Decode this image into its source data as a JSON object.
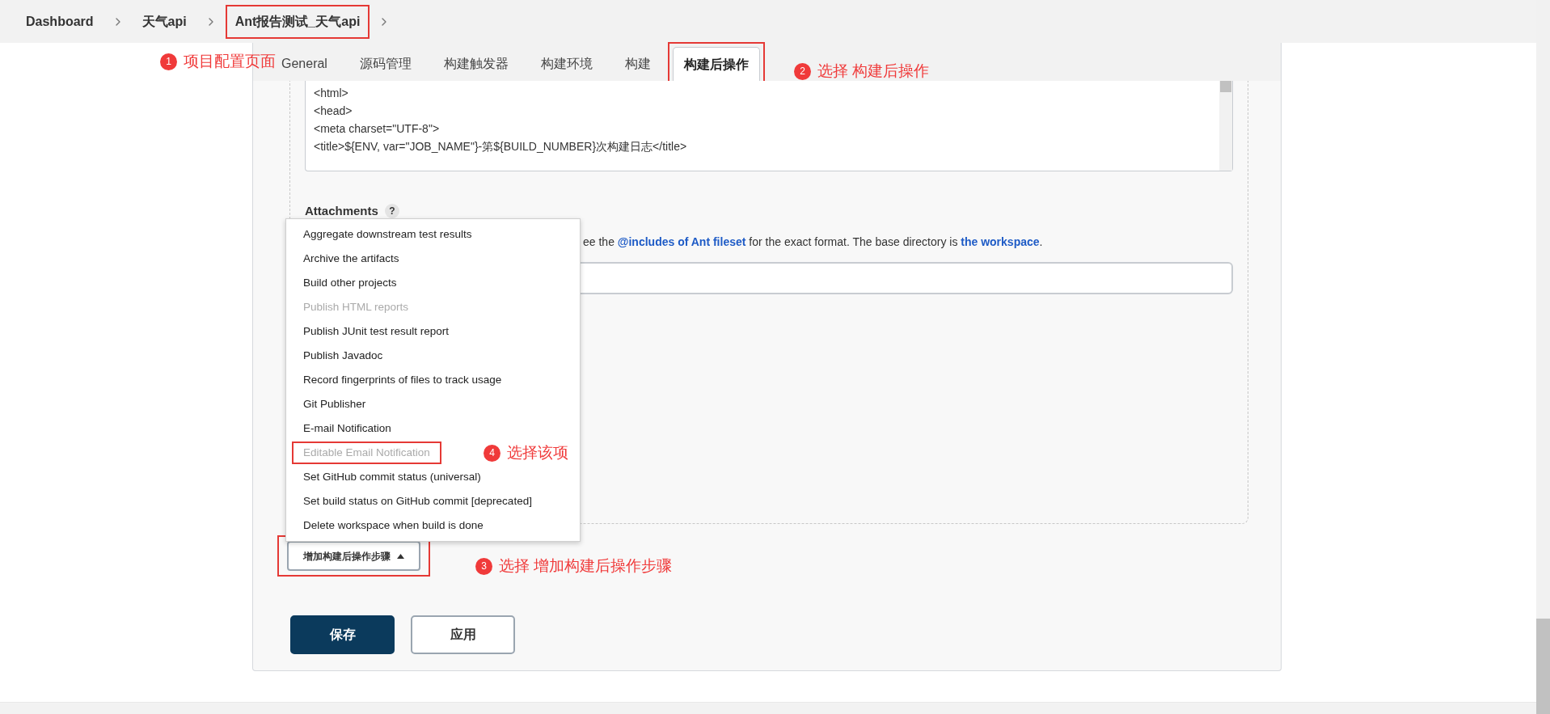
{
  "breadcrumbs": [
    {
      "label": "Dashboard",
      "boxed": false
    },
    {
      "label": "天气api",
      "boxed": false
    },
    {
      "label": "Ant报告测试_天气api",
      "boxed": true
    }
  ],
  "tabs": [
    {
      "label": "General",
      "selected": false,
      "boxed": false
    },
    {
      "label": "源码管理",
      "selected": false,
      "boxed": false
    },
    {
      "label": "构建触发器",
      "selected": false,
      "boxed": false
    },
    {
      "label": "构建环境",
      "selected": false,
      "boxed": false
    },
    {
      "label": "构建",
      "selected": false,
      "boxed": false
    },
    {
      "label": "构建后操作",
      "selected": true,
      "boxed": true
    }
  ],
  "editor": {
    "lines": [
      "<html>",
      "<head>",
      "<meta charset=\"UTF-8\">",
      "<title>${ENV, var=\"JOB_NAME\"}-第${BUILD_NUMBER}次构建日志</title>"
    ]
  },
  "attachments": {
    "label": "Attachments",
    "help": "?",
    "description": {
      "before": "ee the",
      "link_1": "@includes of Ant fileset",
      "middle": "for the exact format. The base directory is",
      "link_2": "the workspace",
      "after": "."
    }
  },
  "menu": [
    {
      "label": "Aggregate downstream test results",
      "disabled": false,
      "boxed": false
    },
    {
      "label": "Archive the artifacts",
      "disabled": false,
      "boxed": false
    },
    {
      "label": "Build other projects",
      "disabled": false,
      "boxed": false
    },
    {
      "label": "Publish HTML reports",
      "disabled": true,
      "boxed": false
    },
    {
      "label": "Publish JUnit test result report",
      "disabled": false,
      "boxed": false
    },
    {
      "label": "Publish Javadoc",
      "disabled": false,
      "boxed": false
    },
    {
      "label": "Record fingerprints of files to track usage",
      "disabled": false,
      "boxed": false
    },
    {
      "label": "Git Publisher",
      "disabled": false,
      "boxed": false
    },
    {
      "label": "E-mail Notification",
      "disabled": false,
      "boxed": false
    },
    {
      "label": "Editable Email Notification",
      "disabled": true,
      "boxed": true
    },
    {
      "label": "Set GitHub commit status (universal)",
      "disabled": false,
      "boxed": false
    },
    {
      "label": "Set build status on GitHub commit [deprecated]",
      "disabled": false,
      "boxed": false
    },
    {
      "label": "Delete workspace when build is done",
      "disabled": false,
      "boxed": false
    }
  ],
  "add_step_button": {
    "label": "增加构建后操作步骤",
    "boxed": true
  },
  "buttons": [
    {
      "label": "保存",
      "kind": "primary"
    },
    {
      "label": "应用",
      "kind": "secondary"
    }
  ],
  "annotations": [
    {
      "number": "1",
      "text": "项目配置页面"
    },
    {
      "number": "2",
      "text": "选择 构建后操作"
    },
    {
      "number": "4",
      "text": "选择该项"
    },
    {
      "number": "3",
      "text": "选择 增加构建后操作步骤"
    }
  ]
}
